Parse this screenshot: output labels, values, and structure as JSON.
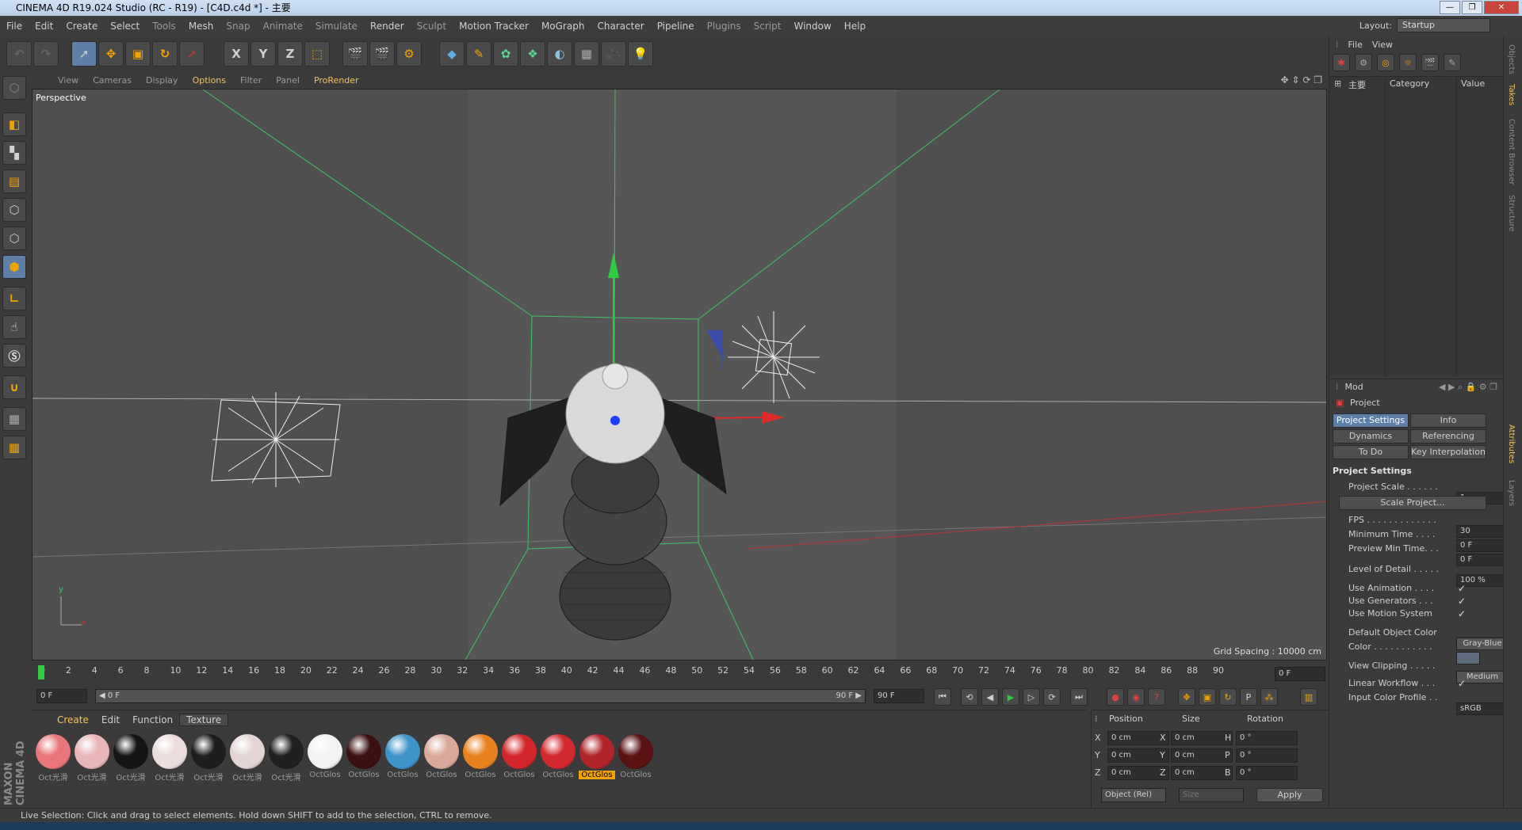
{
  "window": {
    "title": "CINEMA 4D R19.024 Studio (RC - R19) - [C4D.c4d *] - 主要",
    "min": "—",
    "max": "❐",
    "close": "✕"
  },
  "menu": [
    "File",
    "Edit",
    "Create",
    "Select",
    "Tools",
    "Mesh",
    "Snap",
    "Animate",
    "Simulate",
    "Render",
    "Sculpt",
    "Motion Tracker",
    "MoGraph",
    "Character",
    "Pipeline",
    "Plugins",
    "Script",
    "Window",
    "Help"
  ],
  "layout": {
    "label": "Layout:",
    "value": "Startup"
  },
  "toolbar": {
    "x": "X",
    "y": "Y",
    "z": "Z"
  },
  "viewport": {
    "menu": [
      "View",
      "Cameras",
      "Display",
      "Options",
      "Filter",
      "Panel",
      "ProRender"
    ],
    "name": "Perspective",
    "grid_spacing": "Grid Spacing : 10000 cm",
    "axis_y": "y",
    "axis_x": "x"
  },
  "timeline": {
    "ticks": [
      "0",
      "2",
      "4",
      "6",
      "8",
      "10",
      "12",
      "14",
      "16",
      "18",
      "20",
      "22",
      "24",
      "26",
      "28",
      "30",
      "32",
      "34",
      "36",
      "38",
      "40",
      "42",
      "44",
      "46",
      "48",
      "50",
      "52",
      "54",
      "56",
      "58",
      "60",
      "62",
      "64",
      "66",
      "68",
      "70",
      "72",
      "74",
      "76",
      "78",
      "80",
      "82",
      "84",
      "86",
      "88",
      "90"
    ],
    "current_frame": "0 F",
    "start": "0 F",
    "slider_left": "◀ 0 F",
    "slider_right": "90 F ▶",
    "end": "90 F"
  },
  "materials": {
    "tabs": [
      "Create",
      "Edit",
      "Function",
      "Texture"
    ],
    "items": [
      {
        "label": "Oct光滑",
        "color": "#e7757a"
      },
      {
        "label": "Oct光滑",
        "color": "#e9b6b8"
      },
      {
        "label": "Oct光滑",
        "color": "#151515"
      },
      {
        "label": "Oct光滑",
        "color": "#ecdcdc"
      },
      {
        "label": "Oct光滑",
        "color": "#1e1e1e"
      },
      {
        "label": "Oct光滑",
        "color": "#e4d4d4"
      },
      {
        "label": "Oct光滑",
        "color": "#202020"
      },
      {
        "label": "OctGlos",
        "color": "#f2f2f2"
      },
      {
        "label": "OctGlos",
        "color": "#3a1010"
      },
      {
        "label": "OctGlos",
        "color": "#3e93c8"
      },
      {
        "label": "OctGlos",
        "color": "#d9a89a"
      },
      {
        "label": "OctGlos",
        "color": "#e8821f"
      },
      {
        "label": "OctGlos",
        "color": "#d3262a"
      },
      {
        "label": "OctGlos",
        "color": "#d22a2e"
      },
      {
        "label": "OctGlos",
        "color": "#b1242a"
      },
      {
        "label": "OctGlos",
        "color": "#5a1214"
      }
    ],
    "selected_index": 14
  },
  "coords": {
    "headers": [
      "Position",
      "Size",
      "Rotation"
    ],
    "rows": [
      {
        "a": "X",
        "av": "0 cm",
        "b": "X",
        "bv": "0 cm",
        "c": "H",
        "cv": "0 °"
      },
      {
        "a": "Y",
        "av": "0 cm",
        "b": "Y",
        "bv": "0 cm",
        "c": "P",
        "cv": "0 °"
      },
      {
        "a": "Z",
        "av": "0 cm",
        "b": "Z",
        "bv": "0 cm",
        "c": "B",
        "cv": "0 °"
      }
    ],
    "mode": "Object (Rel)",
    "size_mode": "Size",
    "apply": "Apply"
  },
  "objects": {
    "menu": [
      "File",
      "View"
    ],
    "tree_item": "主要",
    "cols": [
      "Category",
      "Value"
    ]
  },
  "attributes": {
    "mode": "Mod",
    "title": "Project",
    "tabs": [
      "Project Settings",
      "Info",
      "Dynamics",
      "Referencing",
      "To Do",
      "Key Interpolation"
    ],
    "section": "Project Settings",
    "rows": [
      {
        "label": "Project Scale . . . . . .",
        "value": "1"
      },
      {
        "label": "Scale Project...",
        "value": ""
      },
      {
        "label": "FPS . . . . . . . . . . . . .",
        "value": "30"
      },
      {
        "label": "Minimum Time . . . .",
        "value": "0 F"
      },
      {
        "label": "Preview Min Time. . .",
        "value": "0 F"
      },
      {
        "label": "Level of Detail . . . . .",
        "value": "100 %"
      },
      {
        "label": "Use Animation . . . .",
        "value": "✓"
      },
      {
        "label": "Use Generators . . .",
        "value": "✓"
      },
      {
        "label": "Use Motion System",
        "value": "✓"
      },
      {
        "label": "Default Object Color",
        "value": "Gray-Blue"
      },
      {
        "label": "Color . . . . . . . . . . .",
        "value": ""
      },
      {
        "label": "View Clipping . . . . .",
        "value": "Medium"
      },
      {
        "label": "Linear Workflow . . .",
        "value": "✓"
      },
      {
        "label": "Input Color Profile . .",
        "value": "sRGB"
      }
    ]
  },
  "rail_tabs": [
    "Objects",
    "Takes",
    "Content Browser",
    "Structure",
    "Attributes",
    "Layers"
  ],
  "status": "Live Selection: Click and drag to select elements. Hold down SHIFT to add to the selection, CTRL to remove.",
  "brand": "MAXON CINEMA 4D"
}
